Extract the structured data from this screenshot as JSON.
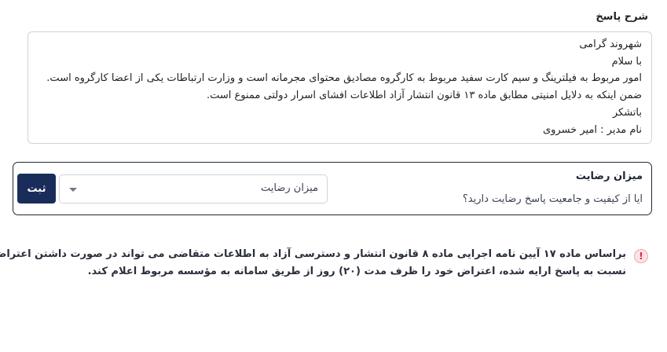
{
  "answer": {
    "label": "شرح پاسخ",
    "lines": [
      "شهروند گرامی",
      "با سلام",
      "امور مربوط به فیلترینگ و سیم کارت سفید مربوط به کارگروه مصادیق محتوای مجرمانه است و وزارت ارتباطات یکی از اعضا کارگروه است.",
      "ضمن اینکه به دلایل امنیتی مطابق ماده ۱۳ قانون انتشار آزاد اطلاعات افشای اسرار دولتی ممنوع است.",
      "باتشکر",
      "نام مدیر : امیر خسروی"
    ]
  },
  "rating": {
    "title": "میزان رضایت",
    "question": "ایا از کیفیت و جامعیت پاسخ رضایت دارید؟",
    "select_value": "میزان رضایت",
    "submit_label": "ثبت"
  },
  "notice": {
    "icon": "!",
    "lines": [
      "براساس ماده ۱۷ آیین نامه اجرایی ماده ۸ قانون انتشار و دسترسی آزاد به اطلاعات متقاضی می تواند در صورت داشتن اعتراض",
      "نسبت به پاسخ ارایه شده، اعتراض خود را ظرف مدت (۲۰) روز از طریق سامانه به مؤسسه مربوط اعلام کند."
    ]
  },
  "colors": {
    "submit_bg": "#1a2d5a",
    "card_border": "#1e2a38",
    "warning": "#e0263f"
  }
}
